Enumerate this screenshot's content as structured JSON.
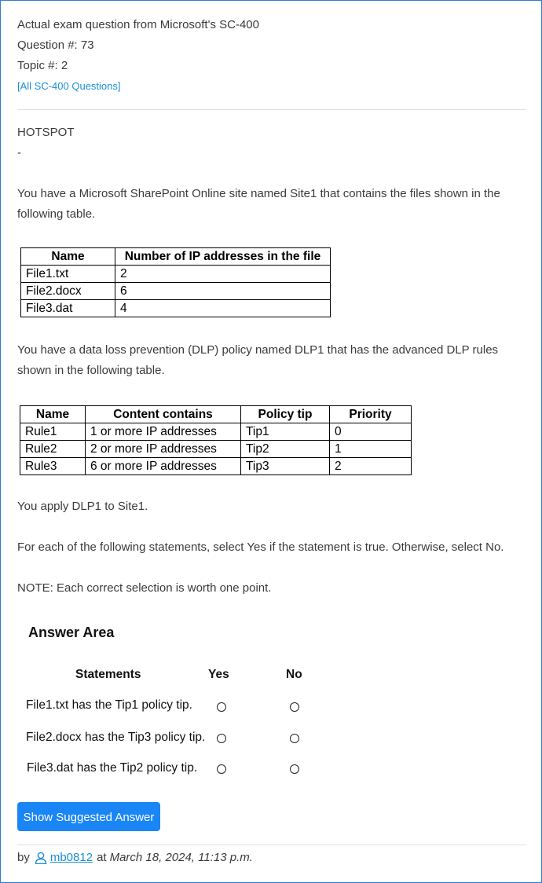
{
  "header": {
    "line1": "Actual exam question from Microsoft's SC-400",
    "question_number": "Question #: 73",
    "topic": "Topic #: 2",
    "all_questions_link": "[All SC-400 Questions]"
  },
  "question": {
    "type": "HOTSPOT",
    "dash": "-",
    "intro": "You have a Microsoft SharePoint Online site named Site1 that contains the files shown in the following table.",
    "files_table": {
      "headers": [
        "Name",
        "Number of IP addresses in the file"
      ],
      "rows": [
        [
          "File1.txt",
          "2"
        ],
        [
          "File2.docx",
          "6"
        ],
        [
          "File3.dat",
          "4"
        ]
      ]
    },
    "dlp_intro": "You have a data loss prevention (DLP) policy named DLP1 that has the advanced DLP rules shown in the following table.",
    "rules_table": {
      "headers": [
        "Name",
        "Content contains",
        "Policy tip",
        "Priority"
      ],
      "rows": [
        [
          "Rule1",
          "1 or more IP addresses",
          "Tip1",
          "0"
        ],
        [
          "Rule2",
          "2 or more IP addresses",
          "Tip2",
          "1"
        ],
        [
          "Rule3",
          "6 or more IP addresses",
          "Tip3",
          "2"
        ]
      ]
    },
    "apply": "You apply DLP1 to Site1.",
    "instruction": "For each of the following statements, select Yes if the statement is true. Otherwise, select No.",
    "note": "NOTE: Each correct selection is worth one point."
  },
  "answer_area": {
    "title": "Answer Area",
    "col_statements": "Statements",
    "col_yes": "Yes",
    "col_no": "No",
    "statements": [
      "File1.txt has the Tip1 policy tip.",
      "File2.docx has the Tip3 policy tip.",
      "File3.dat has the Tip2 policy tip."
    ]
  },
  "actions": {
    "show_answer": "Show Suggested Answer"
  },
  "byline": {
    "by": "by",
    "user": "mb0812",
    "at": "at",
    "date": "March 18, 2024, 11:13 p.m."
  },
  "colors": {
    "link": "#1a8fd6",
    "button": "#1a86f5",
    "frame_border": "#2d7bd6"
  }
}
